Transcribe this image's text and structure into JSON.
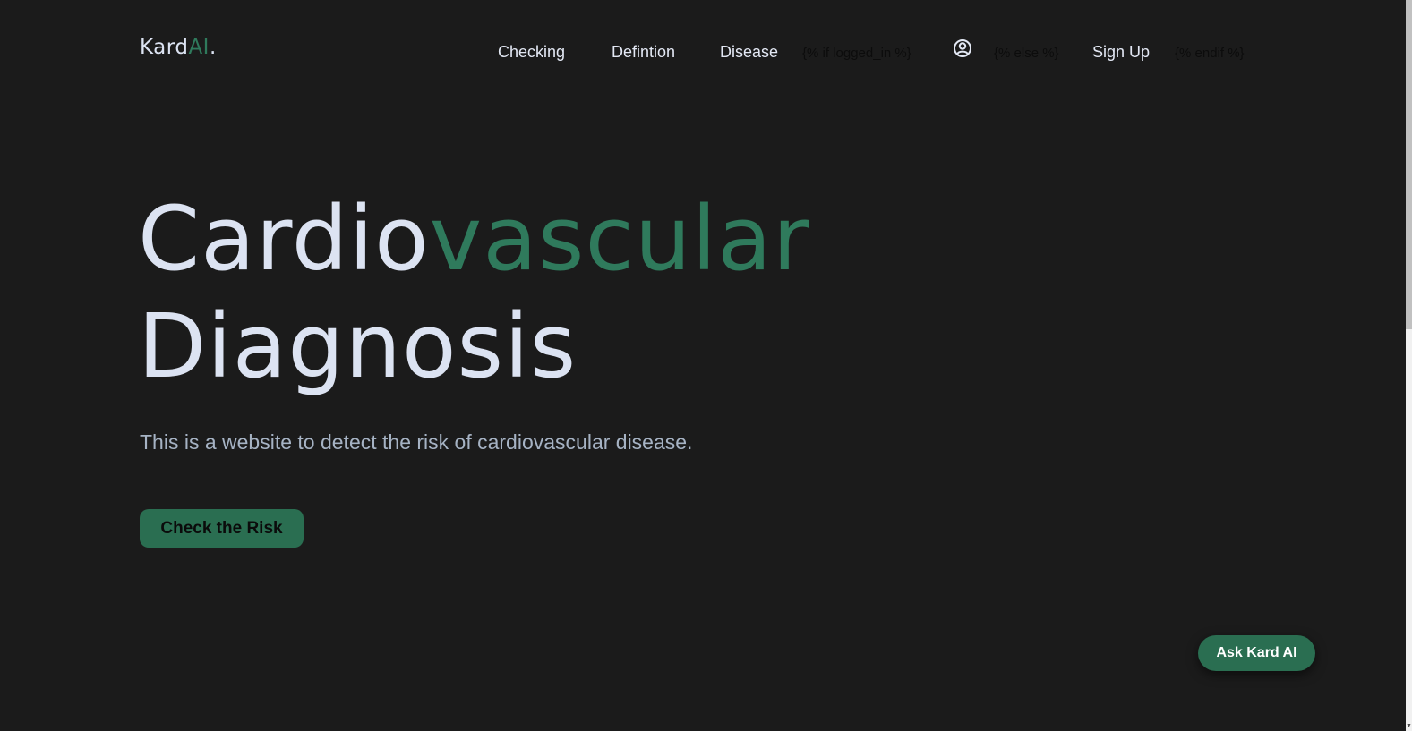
{
  "logo": {
    "text_main": "Kard",
    "text_accent": "AI",
    "text_dot": "."
  },
  "nav": {
    "items": [
      {
        "label": "Checking"
      },
      {
        "label": "Defintion"
      },
      {
        "label": "Disease"
      }
    ],
    "template_if": "{% if logged_in %}",
    "profile_icon": "user-circle-icon",
    "template_else": "{% else %}",
    "signup_label": "Sign Up",
    "template_endif": "{% endif %}"
  },
  "hero": {
    "title_part1": "Cardio",
    "title_part2": "vascular",
    "title_line2": "Diagnosis",
    "subtitle": "This is a website to detect the risk of cardiovascular disease.",
    "cta_label": "Check the Risk"
  },
  "chat": {
    "button_label": "Ask Kard AI"
  },
  "colors": {
    "background": "#1b1b1b",
    "text_primary": "#dce3f2",
    "accent_green": "#2f7a5c",
    "button_green": "#2a6e51",
    "subtitle": "#a6b3c4"
  }
}
